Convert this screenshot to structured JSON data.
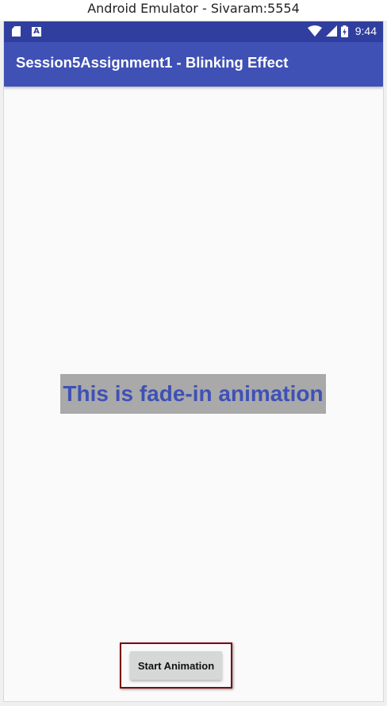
{
  "window": {
    "title": "Android Emulator - Sivaram:5554"
  },
  "status_bar": {
    "left_icons": [
      "sd-card-icon",
      "a-notification-icon"
    ],
    "a_icon_glyph": "A",
    "right_icons": [
      "wifi-icon",
      "signal-icon",
      "battery-charging-icon"
    ],
    "time": "9:44",
    "background_color": "#303f9f"
  },
  "app_bar": {
    "title": "Session5Assignment1 - Blinking Effect",
    "background_color": "#3f51b5"
  },
  "main": {
    "animated_text": "This is fade-in animation",
    "animated_text_color": "#3f51b5",
    "animated_text_background": "#a9a9a9",
    "start_button_label": "Start Animation",
    "highlight_color": "#7a0a14"
  }
}
